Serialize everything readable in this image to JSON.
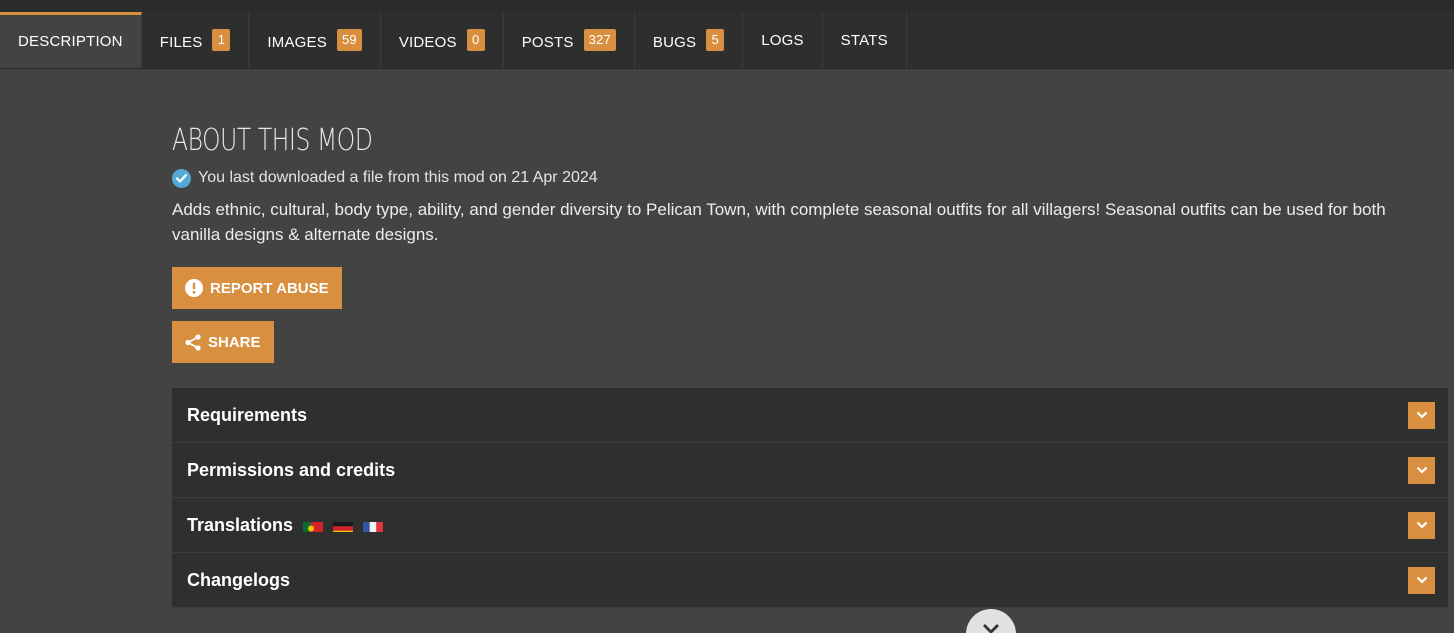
{
  "tabs": [
    {
      "label": "DESCRIPTION",
      "badge": null,
      "active": true
    },
    {
      "label": "FILES",
      "badge": "1"
    },
    {
      "label": "IMAGES",
      "badge": "59"
    },
    {
      "label": "VIDEOS",
      "badge": "0"
    },
    {
      "label": "POSTS",
      "badge": "327"
    },
    {
      "label": "BUGS",
      "badge": "5"
    },
    {
      "label": "LOGS",
      "badge": null
    },
    {
      "label": "STATS",
      "badge": null
    }
  ],
  "about": {
    "title": "ABOUT THIS MOD",
    "download_note": "You last downloaded a file from this mod on 21 Apr 2024",
    "description": "Adds ethnic, cultural, body type, ability, and gender diversity to Pelican Town, with complete seasonal outfits for all villagers! Seasonal outfits can be used for both vanilla designs & alternate designs."
  },
  "buttons": {
    "report": "REPORT ABUSE",
    "share": "SHARE"
  },
  "accordion": [
    {
      "label": "Requirements"
    },
    {
      "label": "Permissions and credits"
    },
    {
      "label": "Translations",
      "flags": [
        "portugal-flag",
        "germany-flag",
        "france-flag"
      ]
    },
    {
      "label": "Changelogs"
    }
  ],
  "colors": {
    "accent": "#d98f40",
    "background": "#434343",
    "tabbar": "#2e2e2e",
    "panel": "#2f2f2f",
    "check": "#56a8d6"
  }
}
